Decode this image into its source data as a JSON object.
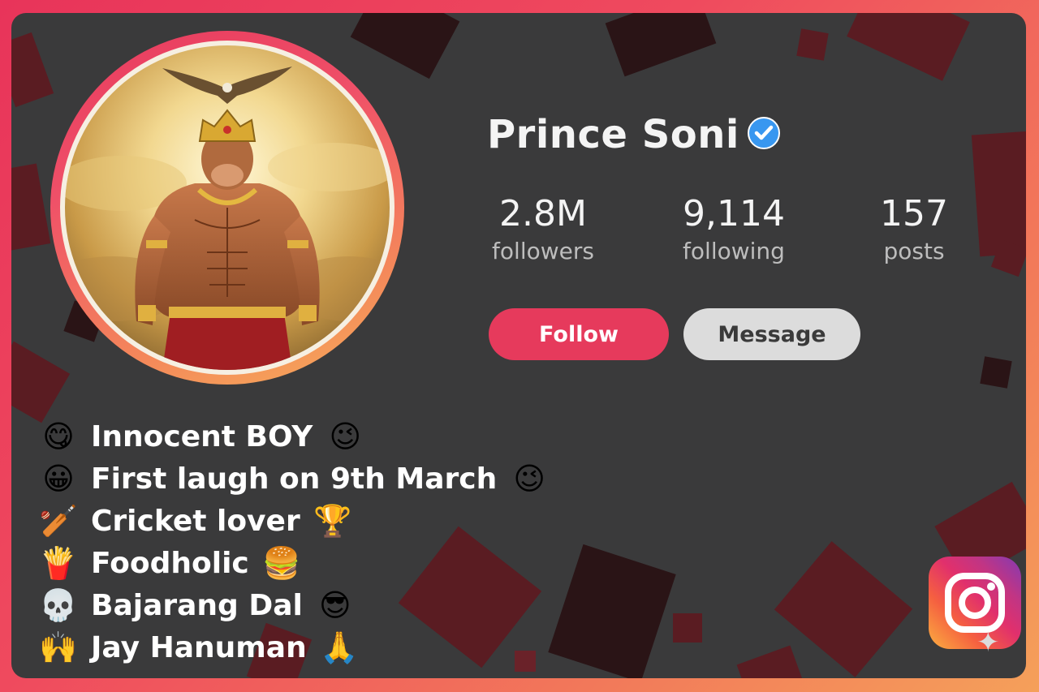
{
  "profile": {
    "name": "Prince Soni",
    "verified": true,
    "stats": [
      {
        "value": "2.8M",
        "label": "followers"
      },
      {
        "value": "9,114",
        "label": "following"
      },
      {
        "value": "157",
        "label": "posts"
      }
    ],
    "buttons": {
      "follow": "Follow",
      "message": "Message"
    }
  },
  "bio": [
    {
      "icon": "face-savoring-food-icon",
      "lead": "😋",
      "text": "Innocent BOY",
      "trail": "😉"
    },
    {
      "icon": "grinning-face-icon",
      "lead": "😀",
      "text": "First laugh on 9th March",
      "trail": "😉"
    },
    {
      "icon": "cricket-bat-icon",
      "lead": "🏏",
      "text": "Cricket lover",
      "trail": "🏆"
    },
    {
      "icon": "fries-icon",
      "lead": "🍟",
      "text": "Foodholic",
      "trail": "🍔"
    },
    {
      "icon": "skull-icon",
      "lead": "💀",
      "text": "Bajarang Dal",
      "trail": "😎"
    },
    {
      "icon": "raising-hands-icon",
      "lead": "🙌",
      "text": "Jay Hanuman",
      "trail": "🙏"
    }
  ],
  "colors": {
    "accent": "#e63a5c",
    "verified": "#3897f0",
    "card_bg": "#3a3a3b"
  }
}
